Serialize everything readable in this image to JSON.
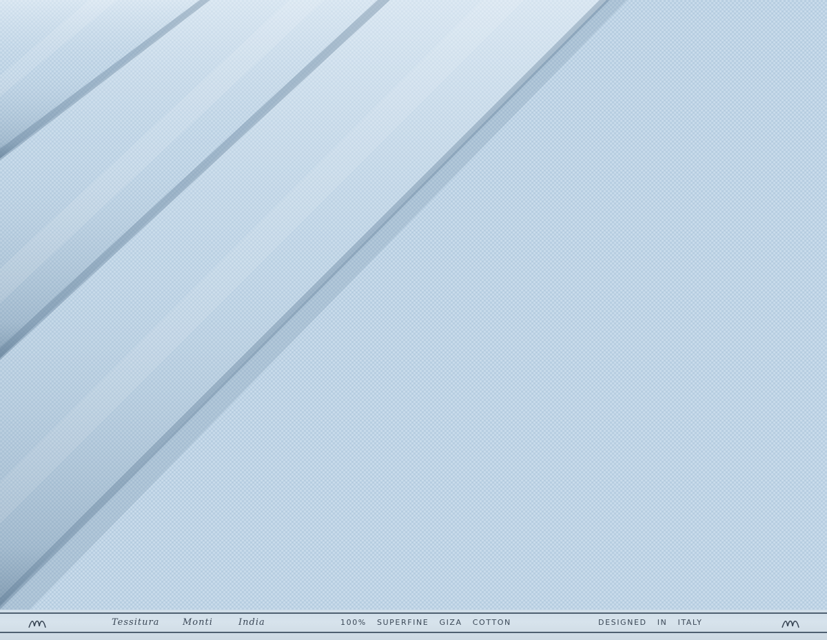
{
  "image": {
    "subject": "fabric",
    "base_color": "#bcd2e4",
    "pattern": "dobby-dot"
  },
  "selvedge": {
    "brand_line": [
      "Tessitura",
      "Monti",
      "India"
    ],
    "composition": "100% SUPERFINE GIZA COTTON",
    "origin": "DESIGNED IN ITALY",
    "logo_icon": "monti-m-logo"
  }
}
